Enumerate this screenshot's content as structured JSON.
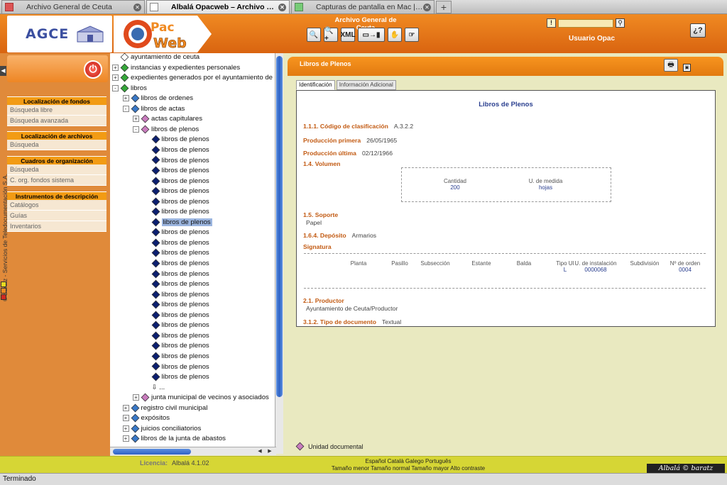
{
  "browser": {
    "tabs": [
      {
        "title": "Archivo General de Ceuta",
        "active": false
      },
      {
        "title": "Albalá Opacweb – Archivo de I...",
        "active": true
      },
      {
        "title": "Capturas de pantalla en Mac | ...",
        "active": false
      }
    ],
    "status": "Terminado"
  },
  "header": {
    "logo_text": "AGCE",
    "pac_logo_top": "Pac",
    "pac_logo_bottom": "Web",
    "title": "Archivo General de Ceuta",
    "tools": [
      "search-icon",
      "zoom-add-icon",
      "XML",
      "export-icon",
      "hand-icon",
      "hand-doc-icon"
    ],
    "xml_label": "XML",
    "user": "Usuario Opac",
    "help_label": "¿?"
  },
  "sidebar": {
    "vertical_credit": "© baratz - Servicios de Teledocumentación S.A.",
    "sections": [
      {
        "title": "Localización de fondos",
        "items": [
          "Búsqueda libre",
          "Búsqueda avanzada"
        ]
      },
      {
        "title": "Localización de archivos",
        "items": [
          "Búsqueda"
        ]
      },
      {
        "title": "Cuadros de organización",
        "items": [
          "Búsqueda",
          "C. org. fondos sistema"
        ]
      },
      {
        "title": "Instrumentos de descripción",
        "items": [
          "Catálogos",
          "Guías",
          "Inventarios"
        ]
      }
    ],
    "dot_colors": [
      "#e8d820",
      "#f08a22",
      "#d02a20"
    ]
  },
  "tree": {
    "rows": [
      {
        "label": "ayuntamiento de ceuta",
        "indent": 0,
        "icon": "white",
        "toggle": ""
      },
      {
        "label": "instancias y expedientes personales",
        "indent": 0,
        "icon": "green",
        "toggle": "+"
      },
      {
        "label": "expedientes generados por el ayuntamiento de ceuta",
        "indent": 0,
        "icon": "green",
        "toggle": "+"
      },
      {
        "label": "libros",
        "indent": 0,
        "icon": "green",
        "toggle": "-"
      },
      {
        "label": "libros de ordenes",
        "indent": 1,
        "icon": "blue",
        "toggle": "+"
      },
      {
        "label": "libros de actas",
        "indent": 1,
        "icon": "blue",
        "toggle": "-"
      },
      {
        "label": "actas capitulares",
        "indent": 2,
        "icon": "pink",
        "toggle": "+"
      },
      {
        "label": "libros de plenos",
        "indent": 2,
        "icon": "pink",
        "toggle": "-"
      },
      {
        "label": "libros de plenos",
        "indent": 3,
        "icon": "navy",
        "toggle": ""
      },
      {
        "label": "libros de plenos",
        "indent": 3,
        "icon": "navy",
        "toggle": ""
      },
      {
        "label": "libros de plenos",
        "indent": 3,
        "icon": "navy",
        "toggle": ""
      },
      {
        "label": "libros de plenos",
        "indent": 3,
        "icon": "navy",
        "toggle": ""
      },
      {
        "label": "libros de plenos",
        "indent": 3,
        "icon": "navy",
        "toggle": ""
      },
      {
        "label": "libros de plenos",
        "indent": 3,
        "icon": "navy",
        "toggle": ""
      },
      {
        "label": "libros de plenos",
        "indent": 3,
        "icon": "navy",
        "toggle": ""
      },
      {
        "label": "libros de plenos",
        "indent": 3,
        "icon": "navy",
        "toggle": ""
      },
      {
        "label": "libros de plenos",
        "indent": 3,
        "icon": "navy",
        "toggle": "",
        "selected": true
      },
      {
        "label": "libros de plenos",
        "indent": 3,
        "icon": "navy",
        "toggle": ""
      },
      {
        "label": "libros de plenos",
        "indent": 3,
        "icon": "navy",
        "toggle": ""
      },
      {
        "label": "libros de plenos",
        "indent": 3,
        "icon": "navy",
        "toggle": ""
      },
      {
        "label": "libros de plenos",
        "indent": 3,
        "icon": "navy",
        "toggle": ""
      },
      {
        "label": "libros de plenos",
        "indent": 3,
        "icon": "navy",
        "toggle": ""
      },
      {
        "label": "libros de plenos",
        "indent": 3,
        "icon": "navy",
        "toggle": ""
      },
      {
        "label": "libros de plenos",
        "indent": 3,
        "icon": "navy",
        "toggle": ""
      },
      {
        "label": "libros de plenos",
        "indent": 3,
        "icon": "navy",
        "toggle": ""
      },
      {
        "label": "libros de plenos",
        "indent": 3,
        "icon": "navy",
        "toggle": ""
      },
      {
        "label": "libros de plenos",
        "indent": 3,
        "icon": "navy",
        "toggle": ""
      },
      {
        "label": "libros de plenos",
        "indent": 3,
        "icon": "navy",
        "toggle": ""
      },
      {
        "label": "libros de plenos",
        "indent": 3,
        "icon": "navy",
        "toggle": ""
      },
      {
        "label": "libros de plenos",
        "indent": 3,
        "icon": "navy",
        "toggle": ""
      },
      {
        "label": "libros de plenos",
        "indent": 3,
        "icon": "navy",
        "toggle": ""
      },
      {
        "label": "libros de plenos",
        "indent": 3,
        "icon": "navy",
        "toggle": ""
      },
      {
        "label": "⇩ ...",
        "indent": 3,
        "icon": "",
        "toggle": ""
      },
      {
        "label": "junta municipal de vecinos y asociados",
        "indent": 2,
        "icon": "pink",
        "toggle": "+"
      },
      {
        "label": "registro civil municipal",
        "indent": 1,
        "icon": "blue",
        "toggle": "+"
      },
      {
        "label": "expósitos",
        "indent": 1,
        "icon": "blue",
        "toggle": "+"
      },
      {
        "label": "juicios conciliatorios",
        "indent": 1,
        "icon": "blue",
        "toggle": "+"
      },
      {
        "label": "libros de la junta de abastos",
        "indent": 1,
        "icon": "blue",
        "toggle": "+"
      }
    ]
  },
  "main": {
    "header_title": "Libros de Plenos",
    "tabs": [
      "Identificación",
      "Información Adicional"
    ],
    "panel_title": "Libros de Plenos",
    "fields": {
      "codigo_label": "1.1.1. Código de clasificación",
      "codigo_value": "A.3.2.2",
      "prod1_label": "Producción primera",
      "prod1_value": "26/05/1965",
      "produ_label": "Producción última",
      "produ_value": "02/12/1966",
      "volumen_label": "1.4. Volumen",
      "cantidad_label": "Cantidad",
      "cantidad_value": "200",
      "medida_label": "U. de medida",
      "medida_value": "hojas",
      "soporte_label": "1.5. Soporte",
      "soporte_value": "Papel",
      "deposito_label": "1.6.4. Depósito",
      "deposito_value": "Armarios",
      "signatura_label": "Signatura",
      "productor_label": "2.1. Productor",
      "productor_value": "Ayuntamiento de Ceuta/Productor",
      "tipodoc_label": "3.1.2. Tipo de documento",
      "tipodoc_value": "Textual"
    },
    "signatura_cols": [
      {
        "label": "Planta",
        "value": ""
      },
      {
        "label": "Pasillo",
        "value": ""
      },
      {
        "label": "Subsección",
        "value": ""
      },
      {
        "label": "Estante",
        "value": ""
      },
      {
        "label": "Balda",
        "value": ""
      },
      {
        "label": "Tipo UI",
        "value": "L"
      },
      {
        "label": "U. de instalación",
        "value": "0000068"
      },
      {
        "label": "Subdivisión",
        "value": ""
      },
      {
        "label": "Nº de orden",
        "value": "0004"
      }
    ],
    "legend": "Unidad documental"
  },
  "footer": {
    "license_label": "Licencia:",
    "license_value": "Albalá 4.1.02",
    "languages": "Español Català Galego Português",
    "sizes": "Tamaño menor Tamaño normal Tamaño mayor Alto contraste",
    "brand": "Albalá © baratz"
  }
}
